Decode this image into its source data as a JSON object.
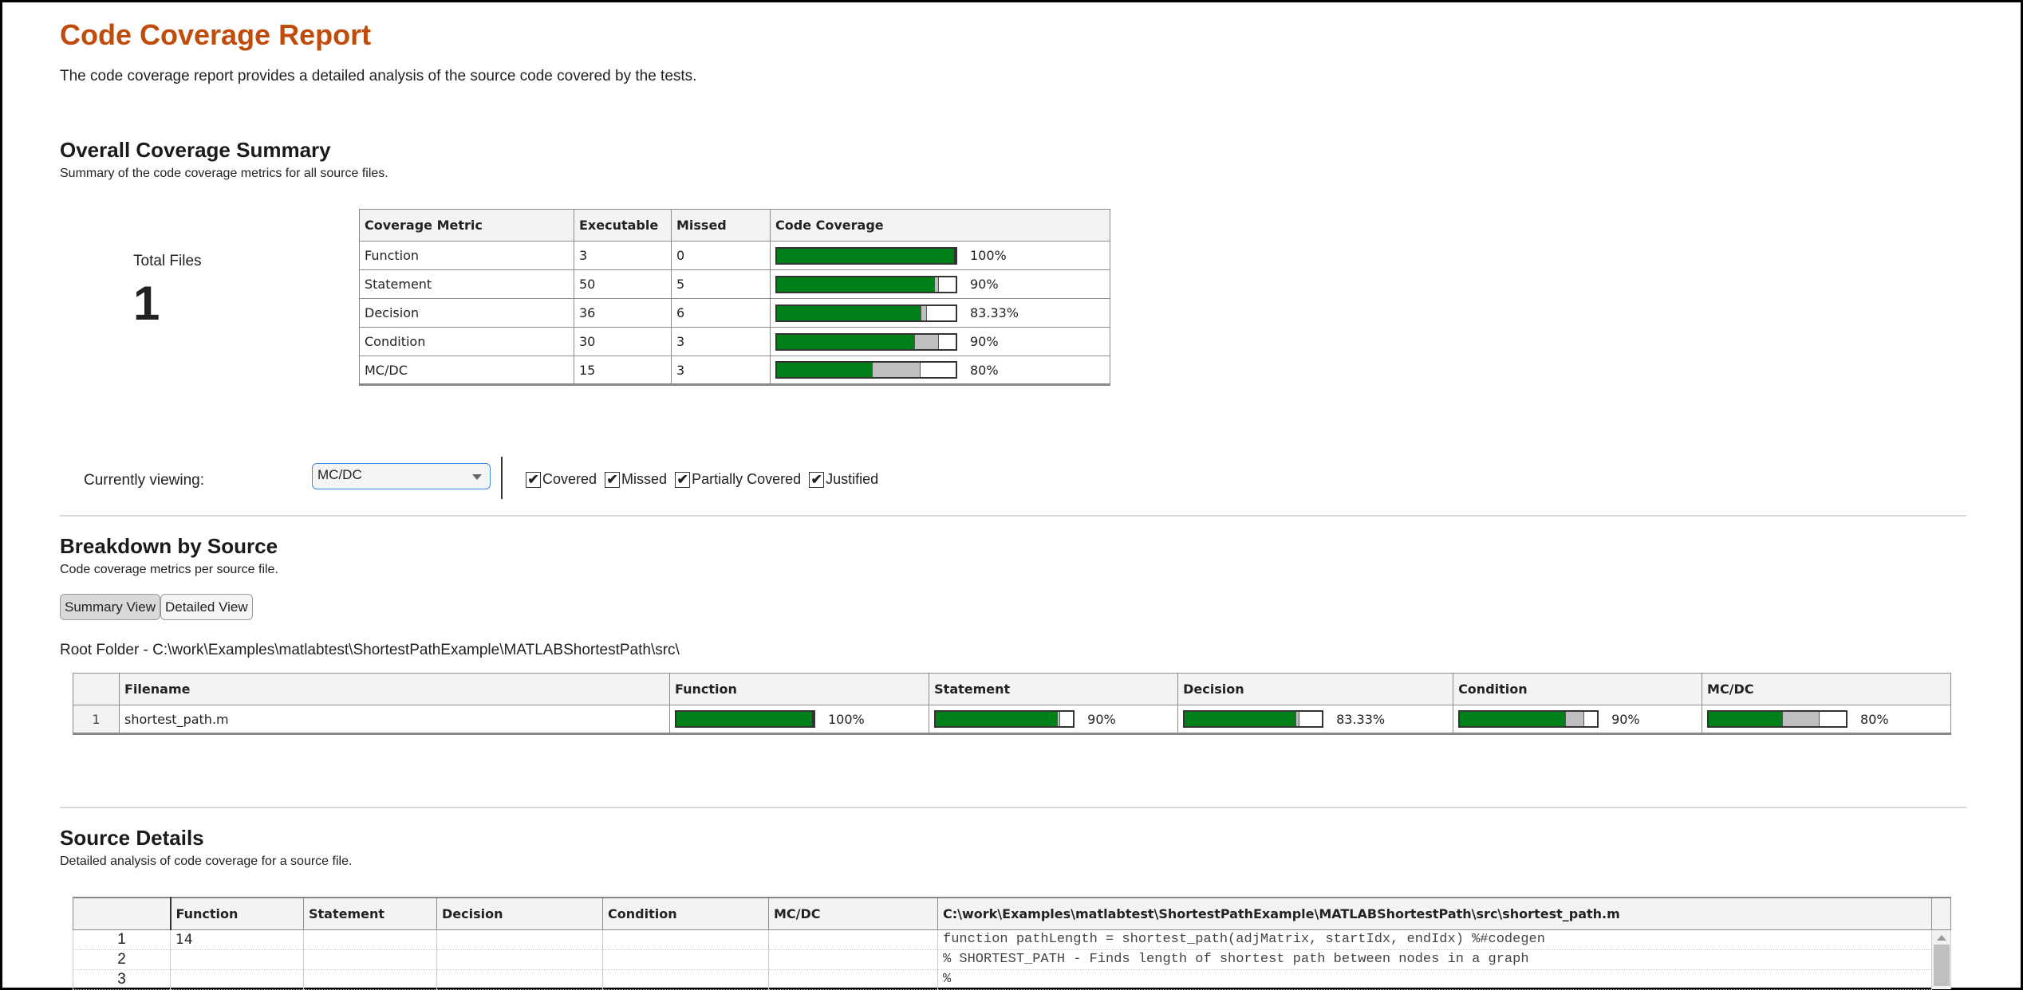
{
  "header": {
    "title": "Code Coverage Report",
    "description": "The code coverage report provides a detailed analysis of the source code covered by the tests."
  },
  "overall": {
    "heading": "Overall Coverage Summary",
    "subheading": "Summary of the code coverage metrics for all source files.",
    "total_files_label": "Total Files",
    "total_files_value": "1",
    "table": {
      "columns": [
        "Coverage Metric",
        "Executable",
        "Missed",
        "Code Coverage"
      ],
      "rows": [
        {
          "metric": "Function",
          "executable": "3",
          "missed": "0",
          "covered_fraction": 1.0,
          "justified_fraction": 0.0,
          "percent": "100%"
        },
        {
          "metric": "Statement",
          "executable": "50",
          "missed": "5",
          "covered_fraction": 0.88,
          "justified_fraction": 0.02,
          "percent": "90%"
        },
        {
          "metric": "Decision",
          "executable": "36",
          "missed": "6",
          "covered_fraction": 0.8056,
          "justified_fraction": 0.0278,
          "percent": "83.33%"
        },
        {
          "metric": "Condition",
          "executable": "30",
          "missed": "3",
          "covered_fraction": 0.7667,
          "justified_fraction": 0.1333,
          "percent": "90%"
        },
        {
          "metric": "MC/DC",
          "executable": "15",
          "missed": "3",
          "covered_fraction": 0.5333,
          "justified_fraction": 0.2667,
          "percent": "80%"
        }
      ]
    }
  },
  "filters": {
    "currently_viewing_label": "Currently viewing:",
    "selected_metric": "MC/DC",
    "checkboxes": [
      {
        "label": "Covered",
        "checked": true
      },
      {
        "label": "Missed",
        "checked": true
      },
      {
        "label": "Partially Covered",
        "checked": true
      },
      {
        "label": "Justified",
        "checked": true
      }
    ]
  },
  "breakdown": {
    "heading": "Breakdown by Source",
    "subheading": "Code coverage metrics per source file.",
    "views": [
      {
        "label": "Summary View",
        "active": true
      },
      {
        "label": "Detailed View",
        "active": false
      }
    ],
    "root_folder": "Root Folder - C:\\work\\Examples\\matlabtest\\ShortestPathExample\\MATLABShortestPath\\src\\",
    "columns": [
      "",
      "Filename",
      "Function",
      "Statement",
      "Decision",
      "Condition",
      "MC/DC"
    ],
    "rows": [
      {
        "index": "1",
        "filename": "shortest_path.m",
        "metrics": [
          {
            "covered_fraction": 1.0,
            "justified_fraction": 0.0,
            "percent": "100%"
          },
          {
            "covered_fraction": 0.88,
            "justified_fraction": 0.02,
            "percent": "90%"
          },
          {
            "covered_fraction": 0.8056,
            "justified_fraction": 0.0278,
            "percent": "83.33%"
          },
          {
            "covered_fraction": 0.7667,
            "justified_fraction": 0.1333,
            "percent": "90%"
          },
          {
            "covered_fraction": 0.5333,
            "justified_fraction": 0.2667,
            "percent": "80%"
          }
        ]
      }
    ]
  },
  "source_details": {
    "heading": "Source Details",
    "subheading": "Detailed analysis of code coverage for a source file.",
    "columns": [
      "",
      "Function",
      "Statement",
      "Decision",
      "Condition",
      "MC/DC",
      "C:\\work\\Examples\\matlabtest\\ShortestPathExample\\MATLABShortestPath\\src\\shortest_path.m"
    ],
    "lines": [
      {
        "line": "1",
        "function": "14",
        "statement": "",
        "decision": "",
        "condition": "",
        "mcdc": "",
        "code": "function pathLength = shortest_path(adjMatrix, startIdx, endIdx) %#codegen"
      },
      {
        "line": "2",
        "function": "",
        "statement": "",
        "decision": "",
        "condition": "",
        "mcdc": "",
        "code": "% SHORTEST_PATH - Finds length of shortest path between nodes in a graph"
      },
      {
        "line": "3",
        "function": "",
        "statement": "",
        "decision": "",
        "condition": "",
        "mcdc": "",
        "code": "%"
      }
    ]
  },
  "colors": {
    "title": "#c04c0b",
    "covered": "#008018",
    "justified": "#bfbfbf",
    "missed": "#ffffff",
    "select_border": "#3c8be0"
  }
}
